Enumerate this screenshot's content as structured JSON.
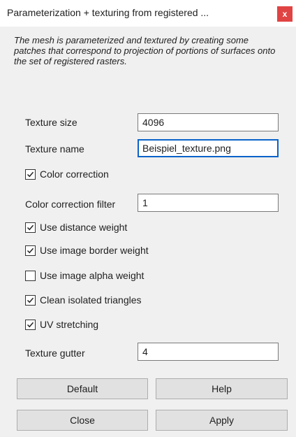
{
  "window": {
    "title": "Parameterization + texturing from registered ...",
    "close_label": "x"
  },
  "description": "The mesh is parameterized and textured by creating some patches that correspond to projection of portions of surfaces onto the set of registered rasters.",
  "fields": {
    "texture_size": {
      "label": "Texture size",
      "value": "4096"
    },
    "texture_name": {
      "label": "Texture name",
      "value": "Beispiel_texture.png"
    },
    "color_correction_filter": {
      "label": "Color correction filter",
      "value": "1"
    },
    "texture_gutter": {
      "label": "Texture gutter",
      "value": "4"
    }
  },
  "checkboxes": {
    "color_correction": {
      "label": "Color correction",
      "checked": true
    },
    "use_distance_weight": {
      "label": "Use distance weight",
      "checked": true
    },
    "use_image_border_weight": {
      "label": "Use image border weight",
      "checked": true
    },
    "use_image_alpha_weight": {
      "label": "Use image alpha weight",
      "checked": false
    },
    "clean_isolated_triangles": {
      "label": "Clean isolated triangles",
      "checked": true
    },
    "uv_stretching": {
      "label": "UV stretching",
      "checked": true
    }
  },
  "buttons": {
    "default": "Default",
    "help": "Help",
    "close": "Close",
    "apply": "Apply"
  },
  "colors": {
    "close_button": "#e04343",
    "focus_border": "#0a63c9",
    "background": "#f0f0f0"
  }
}
